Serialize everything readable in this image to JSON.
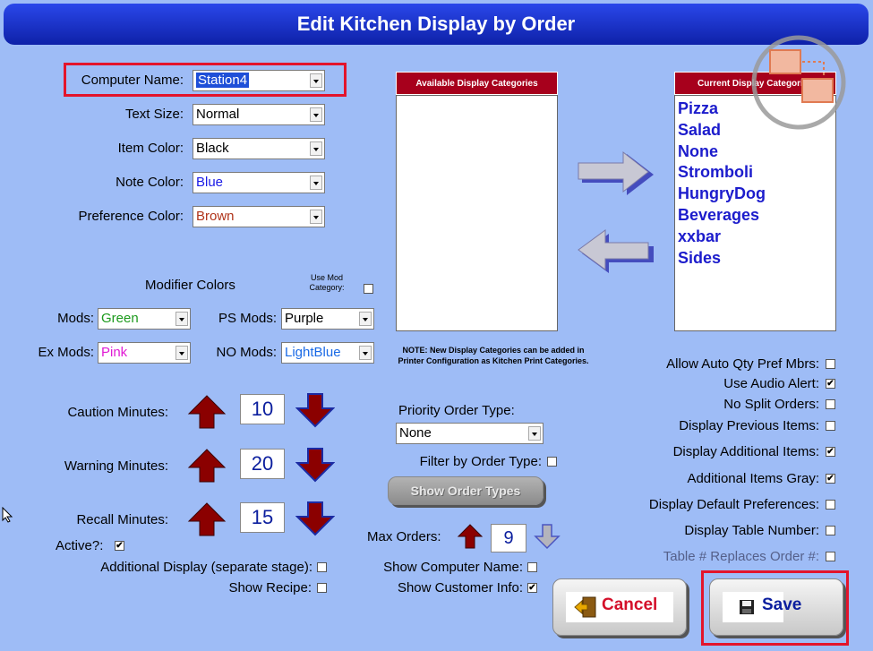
{
  "title": "Edit Kitchen Display by Order",
  "fields": {
    "computer_name": {
      "label": "Computer Name:",
      "value": "Station4"
    },
    "text_size": {
      "label": "Text Size:",
      "value": "Normal"
    },
    "item_color": {
      "label": "Item Color:",
      "value": "Black"
    },
    "note_color": {
      "label": "Note Color:",
      "value": "Blue"
    },
    "preference_color": {
      "label": "Preference Color:",
      "value": "Brown"
    }
  },
  "modifier": {
    "heading": "Modifier Colors",
    "use_mod_category": "Use Mod Category:",
    "mods": {
      "label": "Mods:",
      "value": "Green"
    },
    "ps_mods": {
      "label": "PS Mods:",
      "value": "Purple"
    },
    "ex_mods": {
      "label": "Ex Mods:",
      "value": "Pink"
    },
    "no_mods": {
      "label": "NO Mods:",
      "value": "LightBlue"
    }
  },
  "minutes": {
    "caution": {
      "label": "Caution Minutes:",
      "value": "10"
    },
    "warning": {
      "label": "Warning Minutes:",
      "value": "20"
    },
    "recall": {
      "label": "Recall Minutes:",
      "value": "15"
    }
  },
  "bottom_left": {
    "active": "Active?:",
    "additional_display": "Additional Display (separate stage):",
    "show_recipe": "Show Recipe:"
  },
  "available_categories": {
    "header": "Available Display Categories",
    "items": []
  },
  "current_categories": {
    "header": "Current Display Categories",
    "items": [
      "Pizza",
      "Salad",
      "None",
      "Stromboli",
      "HungryDog",
      "Beverages",
      "xxbar",
      "Sides"
    ]
  },
  "note": "NOTE: New Display Categories can be added in Printer Configuration as Kitchen Print Categories.",
  "priority": {
    "label": "Priority Order Type:",
    "value": "None",
    "filter_label": "Filter by Order Type:",
    "show_types_button": "Show Order Types"
  },
  "max_orders": {
    "label": "Max Orders:",
    "value": "9"
  },
  "show_computer_name": "Show Computer Name:",
  "show_customer_info": "Show Customer Info:",
  "options": [
    {
      "label": "Allow Auto Qty Pref Mbrs:",
      "checked": false
    },
    {
      "label": "Use Audio Alert:",
      "checked": true
    },
    {
      "label": "No Split Orders:",
      "checked": false
    },
    {
      "label": "Display Previous Items:",
      "checked": false
    },
    {
      "label": "Display Additional Items:",
      "checked": true
    },
    {
      "label": "Additional Items Gray:",
      "checked": true
    },
    {
      "label": "Display Default Preferences:",
      "checked": false
    },
    {
      "label": "Display Table Number:",
      "checked": false
    },
    {
      "label": "Table # Replaces Order #:",
      "checked": false
    }
  ],
  "buttons": {
    "cancel": "Cancel",
    "save": "Save"
  },
  "check_mark": "✔",
  "colors": {
    "accent": "#0e21a8",
    "header_red": "#a7001c",
    "arrow_red": "#8b0000",
    "highlight": "#e3142b"
  }
}
